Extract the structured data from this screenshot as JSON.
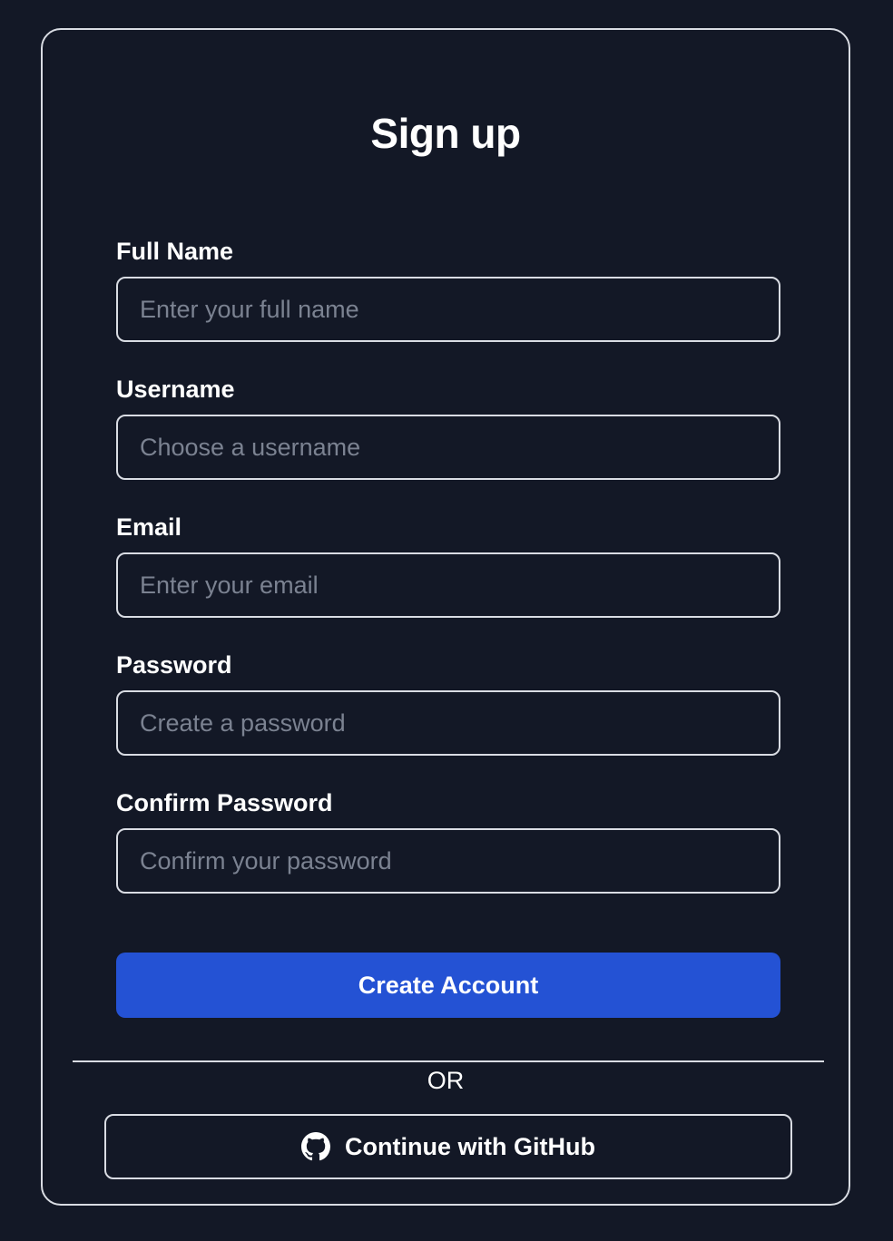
{
  "form": {
    "title": "Sign up",
    "fields": [
      {
        "label": "Full Name",
        "placeholder": "Enter your full name",
        "value": ""
      },
      {
        "label": "Username",
        "placeholder": "Choose a username",
        "value": ""
      },
      {
        "label": "Email",
        "placeholder": "Enter your email",
        "value": ""
      },
      {
        "label": "Password",
        "placeholder": "Create a password",
        "value": ""
      },
      {
        "label": "Confirm Password",
        "placeholder": "Confirm your password",
        "value": ""
      }
    ],
    "submit_label": "Create Account",
    "divider_text": "OR",
    "github": {
      "label": "Continue with GitHub",
      "icon": "github-icon"
    }
  },
  "colors": {
    "background": "#131826",
    "border": "#d9dce3",
    "primary": "#2452d4",
    "placeholder": "#7b8291",
    "text": "#ffffff"
  }
}
